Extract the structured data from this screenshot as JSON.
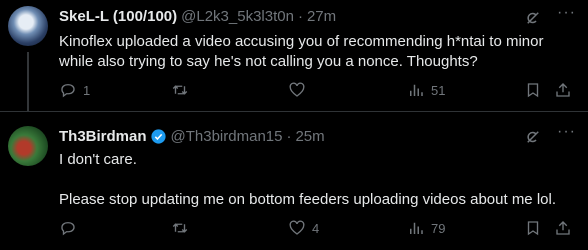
{
  "tweets": [
    {
      "name": "SkeL-L (100/100)",
      "handle": "@L2k3_5k3l3t0n",
      "dot": "·",
      "time": "27m",
      "text_lines": [
        "Kinoflex uploaded a video accusing you of recommending h*ntai to minor while also trying to say he's not calling you a nonce. Thoughts?"
      ],
      "replies": "1",
      "retweets": "",
      "likes": "",
      "views": "51",
      "verified": false
    },
    {
      "name": "Th3Birdman",
      "handle": "@Th3birdman15",
      "dot": "·",
      "time": "25m",
      "text_lines": [
        "I don't care.",
        "Please stop updating me on bottom feeders uploading videos about me lol."
      ],
      "replies": "",
      "retweets": "",
      "likes": "4",
      "views": "79",
      "verified": true
    }
  ],
  "icons": {
    "more": "more-icon",
    "grok": "grok-icon",
    "reply": "reply-icon",
    "retweet": "retweet-icon",
    "like": "heart-icon",
    "views": "views-icon",
    "bookmark": "bookmark-icon",
    "share": "share-icon"
  },
  "colors": {
    "background": "#000000",
    "text": "#e7e9ea",
    "muted": "#71767b",
    "verified": "#1d9bf0",
    "divider": "#2f3336"
  }
}
